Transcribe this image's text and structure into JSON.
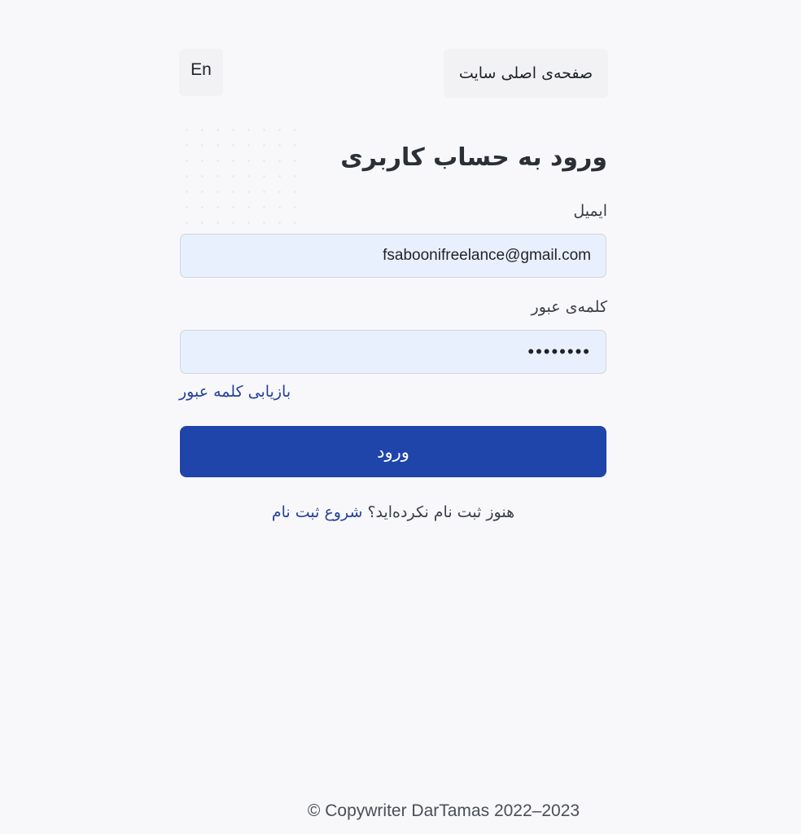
{
  "header": {
    "language_label": "En",
    "home_label": "صفحه‌ی اصلی سایت"
  },
  "form": {
    "title": "ورود به حساب کاربری",
    "email_label": "ایمیل",
    "email_value": "fsaboonifreelance@gmail.com",
    "password_label": "کلمه‌ی عبور",
    "password_value": "••••••••",
    "forgot_label": "بازیابی کلمه عبور",
    "submit_label": "ورود",
    "register_prompt": "هنوز ثبت نام نکرده‌اید؟",
    "register_link": "شروع ثبت نام"
  },
  "footer": {
    "copyright": "© Copywriter DarTamas 2022–2023"
  },
  "colors": {
    "primary": "#1f45aa",
    "link": "#26409c",
    "input_bg": "#e9f0fd",
    "page_bg": "#f8f8fb"
  }
}
